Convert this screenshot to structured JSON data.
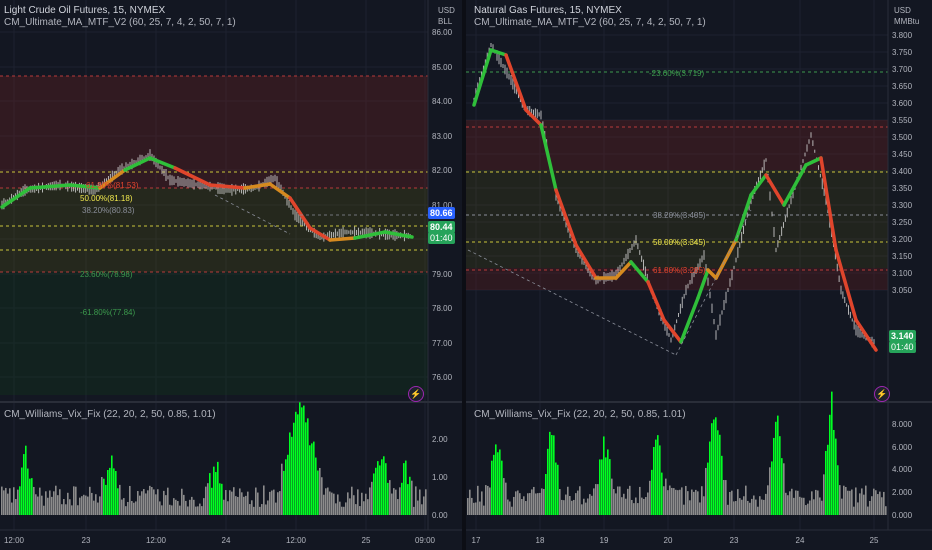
{
  "left": {
    "chart_title": "Light Crude Oil Futures, 15, NYMEX",
    "indicator_label": "CM_Ultimate_MA_MTF_V2 (60, 25, 7, 4, 2, 50, 7, 1)",
    "unit_currency": "USD",
    "unit_measure": "BLL",
    "price_ticks": [
      "86.00",
      "85.00",
      "84.00",
      "83.00",
      "82.00",
      "81.00",
      "80.00",
      "79.00",
      "78.00",
      "77.00",
      "76.00"
    ],
    "fib_labels": [
      "61.80%(81.53)",
      "50.00%(81.18)",
      "38.20%(80.83)",
      "23.60%(78.98)",
      "-61.80%(77.84)"
    ],
    "price_tag": "80.66",
    "last_price_tag": "80.44",
    "countdown": "01:40",
    "lower_indicator": "CM_Williams_Vix_Fix (22, 20, 2, 50, 0.85, 1.01)",
    "lower_ticks": [
      "2.00",
      "1.00",
      "0.00"
    ],
    "time_ticks": [
      "12:00",
      "23",
      "12:00",
      "24",
      "12:00",
      "25",
      "09:00"
    ]
  },
  "right": {
    "chart_title": "Natural Gas Futures, 15, NYMEX",
    "indicator_label": "CM_Ultimate_MA_MTF_V2 (60, 25, 7, 4, 2, 50, 7, 1)",
    "unit_currency": "USD",
    "unit_measure": "MMBtu",
    "price_ticks": [
      "3.800",
      "3.750",
      "3.700",
      "3.650",
      "3.600",
      "3.550",
      "3.500",
      "3.450",
      "3.400",
      "3.350",
      "3.300",
      "3.250",
      "3.200",
      "3.150",
      "3.100",
      "3.050"
    ],
    "fib_labels": [
      "-23.60%(3.719)",
      "38.20%(3.405)",
      "50.00%(3.345)",
      "61.80%(3.285)"
    ],
    "last_price_tag": "3.140",
    "countdown": "01:40",
    "lower_indicator": "CM_Williams_Vix_Fix (22, 20, 2, 50, 0.85, 1.01)",
    "lower_ticks": [
      "8.000",
      "6.000",
      "4.000",
      "2.000",
      "0.000"
    ],
    "time_ticks": [
      "17",
      "18",
      "19",
      "20",
      "23",
      "24",
      "25"
    ]
  },
  "colors": {
    "background": "#131722",
    "ma_up": "#2fbf3a",
    "ma_down": "#e0452c",
    "ma_neutral": "#d68a1f",
    "vix_high": "#00ff22",
    "vix_low": "#8c8c8c",
    "price_tag_blue": "#2962ff",
    "price_tag_green": "#26a35a"
  }
}
